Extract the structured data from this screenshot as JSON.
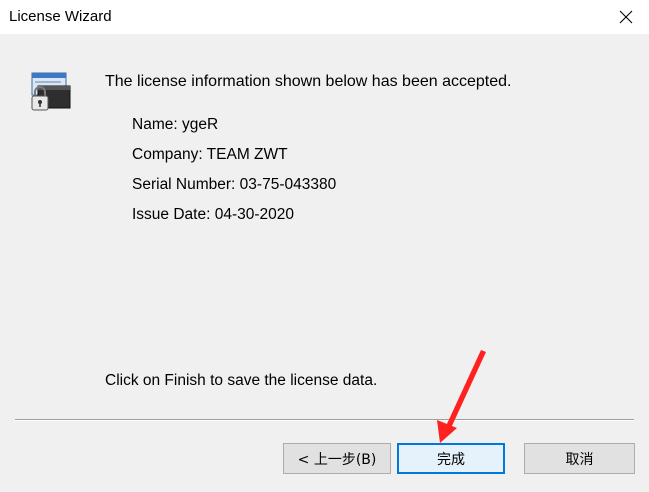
{
  "window": {
    "title": "License Wizard"
  },
  "content": {
    "heading": "The license information shown below has been accepted.",
    "details": [
      "Name: ygeR",
      "Company: TEAM ZWT",
      "Serial Number: 03-75-043380",
      "Issue Date: 04-30-2020"
    ],
    "footer_note": "Click on Finish to save the license data."
  },
  "buttons": {
    "back_label": "< 上一步(B)",
    "finish_label": "完成",
    "cancel_label": "取消"
  },
  "icons": {
    "close": "close-icon",
    "wizard": "license-lock-icon",
    "annotation": "red-arrow-icon"
  },
  "colors": {
    "accent": "#0078d7",
    "annotation": "#ff2020"
  }
}
